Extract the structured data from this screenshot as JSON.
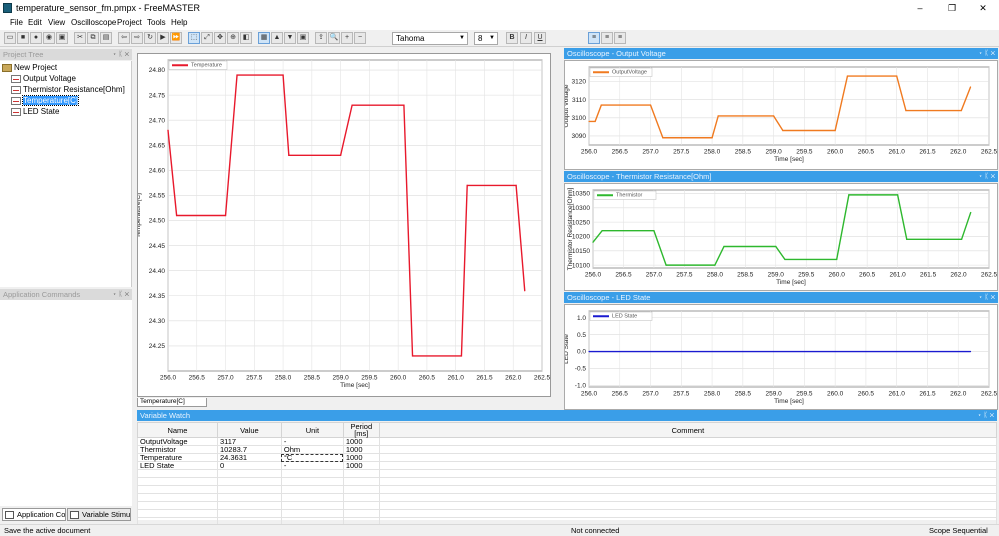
{
  "window": {
    "title": "temperature_sensor_fm.pmpx - FreeMASTER",
    "min": "–",
    "max": "❐",
    "close": "✕"
  },
  "menu": [
    "File",
    "Edit",
    "View",
    "Oscilloscope",
    "Project",
    "Tools",
    "Help"
  ],
  "toolbar": {
    "font": "Tahoma",
    "size": "8",
    "bold": "B",
    "italic": "I",
    "underline": "U",
    "icons": [
      "open-icon",
      "save-icon",
      "go-icon",
      "stop-icon",
      "toggle-icon",
      "cut-icon",
      "copy-icon",
      "paste-icon",
      "back-icon",
      "forward-icon",
      "refresh-icon",
      "rec-icon",
      "fast-forward-icon",
      "select-icon",
      "zoom-fit-icon",
      "pan-icon",
      "zoom-icon",
      "camera-icon",
      "grid-icon",
      "arrow-up-icon",
      "arrow-down-icon",
      "properties-icon",
      "export-icon",
      "magnify-icon",
      "zoom-in-icon",
      "zoom-out-icon",
      "align-left-icon",
      "align-center-icon",
      "align-right-icon"
    ]
  },
  "panels": {
    "project_tree": "Project Tree",
    "app_commands": "Application Commands",
    "osc_output": "Oscilloscope - Output Voltage",
    "osc_therm": "Oscilloscope - Thermistor Resistance[Ohm]",
    "osc_led": "Oscilloscope - LED State",
    "var_watch": "Variable Watch",
    "btns": "▾ ᛕ ✕"
  },
  "tree": {
    "root": "New Project",
    "items": [
      "Output Voltage",
      "Thermistor Resistance[Ohm]",
      "Temperature[C]",
      "LED State"
    ],
    "selected": 2
  },
  "bottom_tabs": [
    "Application Co...",
    "Variable Stimu..."
  ],
  "doc_tab": "Temperature[C]",
  "variables": {
    "headers": [
      "Name",
      "Value",
      "Unit",
      "Period [ms]",
      "Comment"
    ],
    "rows": [
      [
        "OutputVoltage",
        "3117",
        "-",
        "1000",
        ""
      ],
      [
        "Thermistor",
        "10283.7",
        "Ohm",
        "1000",
        ""
      ],
      [
        "Temperature",
        "24.3631",
        "°C",
        "1000",
        ""
      ],
      [
        "LED State",
        "0",
        "-",
        "1000",
        ""
      ]
    ]
  },
  "status": {
    "left": "Save the active document",
    "mid": "Not connected",
    "right": "Scope Sequential"
  },
  "chart_data": [
    {
      "type": "line",
      "title": "",
      "legend": "Temperature",
      "color": "#e8192c",
      "xlabel": "Time [sec]",
      "ylabel": "Temperature[C]",
      "xlim": [
        256.0,
        262.5
      ],
      "ylim": [
        24.2,
        24.82
      ],
      "xticks": [
        "256.0",
        "256.5",
        "257.0",
        "257.5",
        "258.0",
        "258.5",
        "259.0",
        "259.5",
        "260.0",
        "260.5",
        "261.0",
        "261.5",
        "262.0",
        "262.5"
      ],
      "yticks": [
        "24.80",
        "24.75",
        "24.70",
        "24.65",
        "24.60",
        "24.55",
        "24.50",
        "24.45",
        "24.40",
        "24.35",
        "24.30",
        "24.25"
      ],
      "x": [
        256.0,
        256.15,
        257.0,
        257.2,
        258.0,
        258.1,
        259.0,
        259.2,
        260.1,
        260.25,
        261.1,
        261.2,
        262.05,
        262.2
      ],
      "y": [
        24.68,
        24.51,
        24.51,
        24.79,
        24.79,
        24.63,
        24.63,
        24.73,
        24.73,
        24.23,
        24.23,
        24.57,
        24.57,
        24.36
      ]
    },
    {
      "type": "line",
      "title": "",
      "legend": "OutputVoltage",
      "color": "#f07a20",
      "xlabel": "Time [sec]",
      "ylabel": "Output Voltage",
      "xlim": [
        256.0,
        262.5
      ],
      "ylim": [
        3085,
        3128
      ],
      "xticks": [
        "256.0",
        "256.5",
        "257.0",
        "257.5",
        "258.0",
        "258.5",
        "259.0",
        "259.5",
        "260.0",
        "260.5",
        "261.0",
        "261.5",
        "262.0",
        "262.5"
      ],
      "yticks": [
        "3120",
        "3110",
        "3100",
        "3090"
      ],
      "x": [
        256.0,
        256.1,
        256.2,
        257.0,
        257.2,
        258.0,
        258.1,
        259.0,
        259.15,
        260.0,
        260.2,
        261.0,
        261.15,
        262.05,
        262.2
      ],
      "y": [
        3098,
        3098,
        3107,
        3107,
        3089,
        3089,
        3101,
        3101,
        3093,
        3093,
        3123,
        3123,
        3104,
        3104,
        3117
      ]
    },
    {
      "type": "line",
      "title": "",
      "legend": "Thermistor",
      "color": "#2eb82e",
      "xlabel": "Time [sec]",
      "ylabel": "Thermistor Resistance[Ohm]",
      "xlim": [
        256.0,
        262.5
      ],
      "ylim": [
        10090,
        10362
      ],
      "xticks": [
        "256.0",
        "256.5",
        "257.0",
        "257.5",
        "258.0",
        "258.5",
        "259.0",
        "259.5",
        "260.0",
        "260.5",
        "261.0",
        "261.5",
        "262.0",
        "262.5"
      ],
      "yticks": [
        "10350",
        "10300",
        "10250",
        "10200",
        "10150",
        "10100"
      ],
      "x": [
        256.0,
        256.15,
        257.0,
        257.2,
        258.0,
        258.15,
        259.0,
        259.15,
        260.0,
        260.2,
        261.0,
        261.15,
        262.05,
        262.2
      ],
      "y": [
        10180,
        10220,
        10220,
        10100,
        10100,
        10165,
        10165,
        10120,
        10120,
        10345,
        10345,
        10190,
        10190,
        10283.7
      ]
    },
    {
      "type": "line",
      "title": "",
      "legend": "LED State",
      "color": "#1a1ad0",
      "xlabel": "Time [sec]",
      "ylabel": "LED State",
      "xlim": [
        256.0,
        262.5
      ],
      "ylim": [
        -1.05,
        1.2
      ],
      "xticks": [
        "256.0",
        "256.5",
        "257.0",
        "257.5",
        "258.0",
        "258.5",
        "259.0",
        "259.5",
        "260.0",
        "260.5",
        "261.0",
        "261.5",
        "262.0",
        "262.5"
      ],
      "yticks": [
        "1.0",
        "0.5",
        "0.0",
        "-0.5",
        "-1.0"
      ],
      "x": [
        256.0,
        262.2
      ],
      "y": [
        0,
        0
      ]
    }
  ]
}
